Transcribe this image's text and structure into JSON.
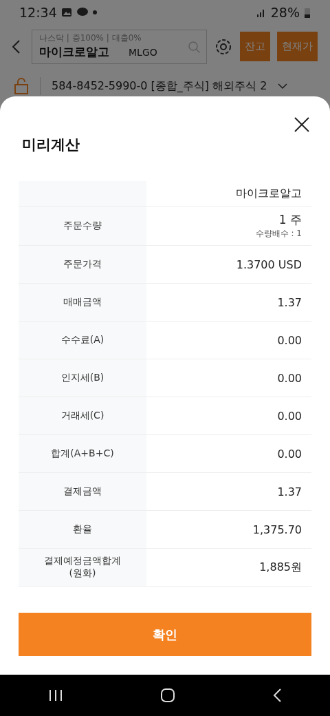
{
  "status_bar": {
    "time": "12:34",
    "battery": "28%"
  },
  "header": {
    "market_info": "나스닥 | 증100% | 대출0%",
    "stock_name": "마이크로알고",
    "ticker": "MLGO",
    "buttons": [
      "잔고",
      "현재가"
    ]
  },
  "account": {
    "text": "584-8452-5990-0  [종합_주식] 해외주식 2"
  },
  "sheet": {
    "title": "미리계산",
    "rows": [
      {
        "label": "",
        "value": "마이크로알고"
      },
      {
        "label": "주문수량",
        "value": "1 주",
        "sub": "수량배수 : 1"
      },
      {
        "label": "주문가격",
        "value": "1.3700 USD"
      },
      {
        "label": "매매금액",
        "value": "1.37"
      },
      {
        "label": "수수료(A)",
        "value": "0.00"
      },
      {
        "label": "인지세(B)",
        "value": "0.00"
      },
      {
        "label": "거래세(C)",
        "value": "0.00"
      },
      {
        "label": "합계(A+B+C)",
        "value": "0.00"
      },
      {
        "label": "결제금액",
        "value": "1.37"
      },
      {
        "label": "환율",
        "value": "1,375.70"
      },
      {
        "label": "결제예정금액합계\n(원화)",
        "value": "1,885원"
      }
    ],
    "confirm": "확인"
  }
}
